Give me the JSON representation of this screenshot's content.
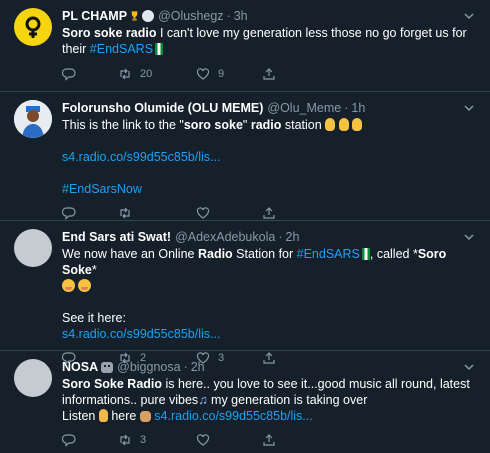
{
  "colors": {
    "background": "#15202b",
    "divider": "#38444d",
    "muted": "#8899a6",
    "link": "#1da1f2"
  },
  "icons": {
    "reply": "reply-icon",
    "retweet": "retweet-icon",
    "like": "heart-icon",
    "share": "share-icon",
    "more": "chevron-down-icon"
  },
  "tweets": [
    {
      "name": "PL CHAMP",
      "name_emoji": [
        "trophy-icon",
        "verified-circle-icon"
      ],
      "handle": "@Olushegz",
      "time": "3h",
      "text_bold": "Soro soke radio",
      "text": " I can't love my generation less those no go forget us for their ",
      "hashtag": "#EndSARS",
      "reply_count": "",
      "retweet_count": "20",
      "like_count": "9"
    },
    {
      "name": "Folorunsho Olumide (OLU MEME)",
      "handle": "@Olu_Meme",
      "time": "1h",
      "line1_pre": "This is the link to the \"",
      "line1_bold": "soro soke",
      "line1_mid": "\" ",
      "line1_bold2": "radio",
      "line1_post": " station",
      "link": "s4.radio.co/s99d55c85b/lis...",
      "hashtag": "#EndSarsNow",
      "reply_count": "",
      "retweet_count": "",
      "like_count": ""
    },
    {
      "name": "End Sars ati Swat!",
      "handle": "@AdexAdebukola",
      "time": "2h",
      "line1_pre": "We now have an Online ",
      "line1_bold": "Radio",
      "line1_mid": " Station for ",
      "hashtag": "#EndSARS",
      "line1_post": ", called *",
      "line1_bold2": "Soro Soke",
      "line1_end": "*",
      "line3": "See it here:",
      "link": "s4.radio.co/s99d55c85b/lis...",
      "reply_count": "",
      "retweet_count": "2",
      "like_count": "3"
    },
    {
      "name": "NOSA",
      "handle": "@biggnosa",
      "time": "2h",
      "text_bold": "Soro Soke Radio",
      "text": " is here.. you love to see it...good music all round, latest informations.. pure vibes",
      "text2": " my generation is taking over",
      "listen": "Listen ",
      "here": " here ",
      "link": "s4.radio.co/s99d55c85b/lis...",
      "reply_count": "",
      "retweet_count": "3",
      "like_count": ""
    }
  ]
}
